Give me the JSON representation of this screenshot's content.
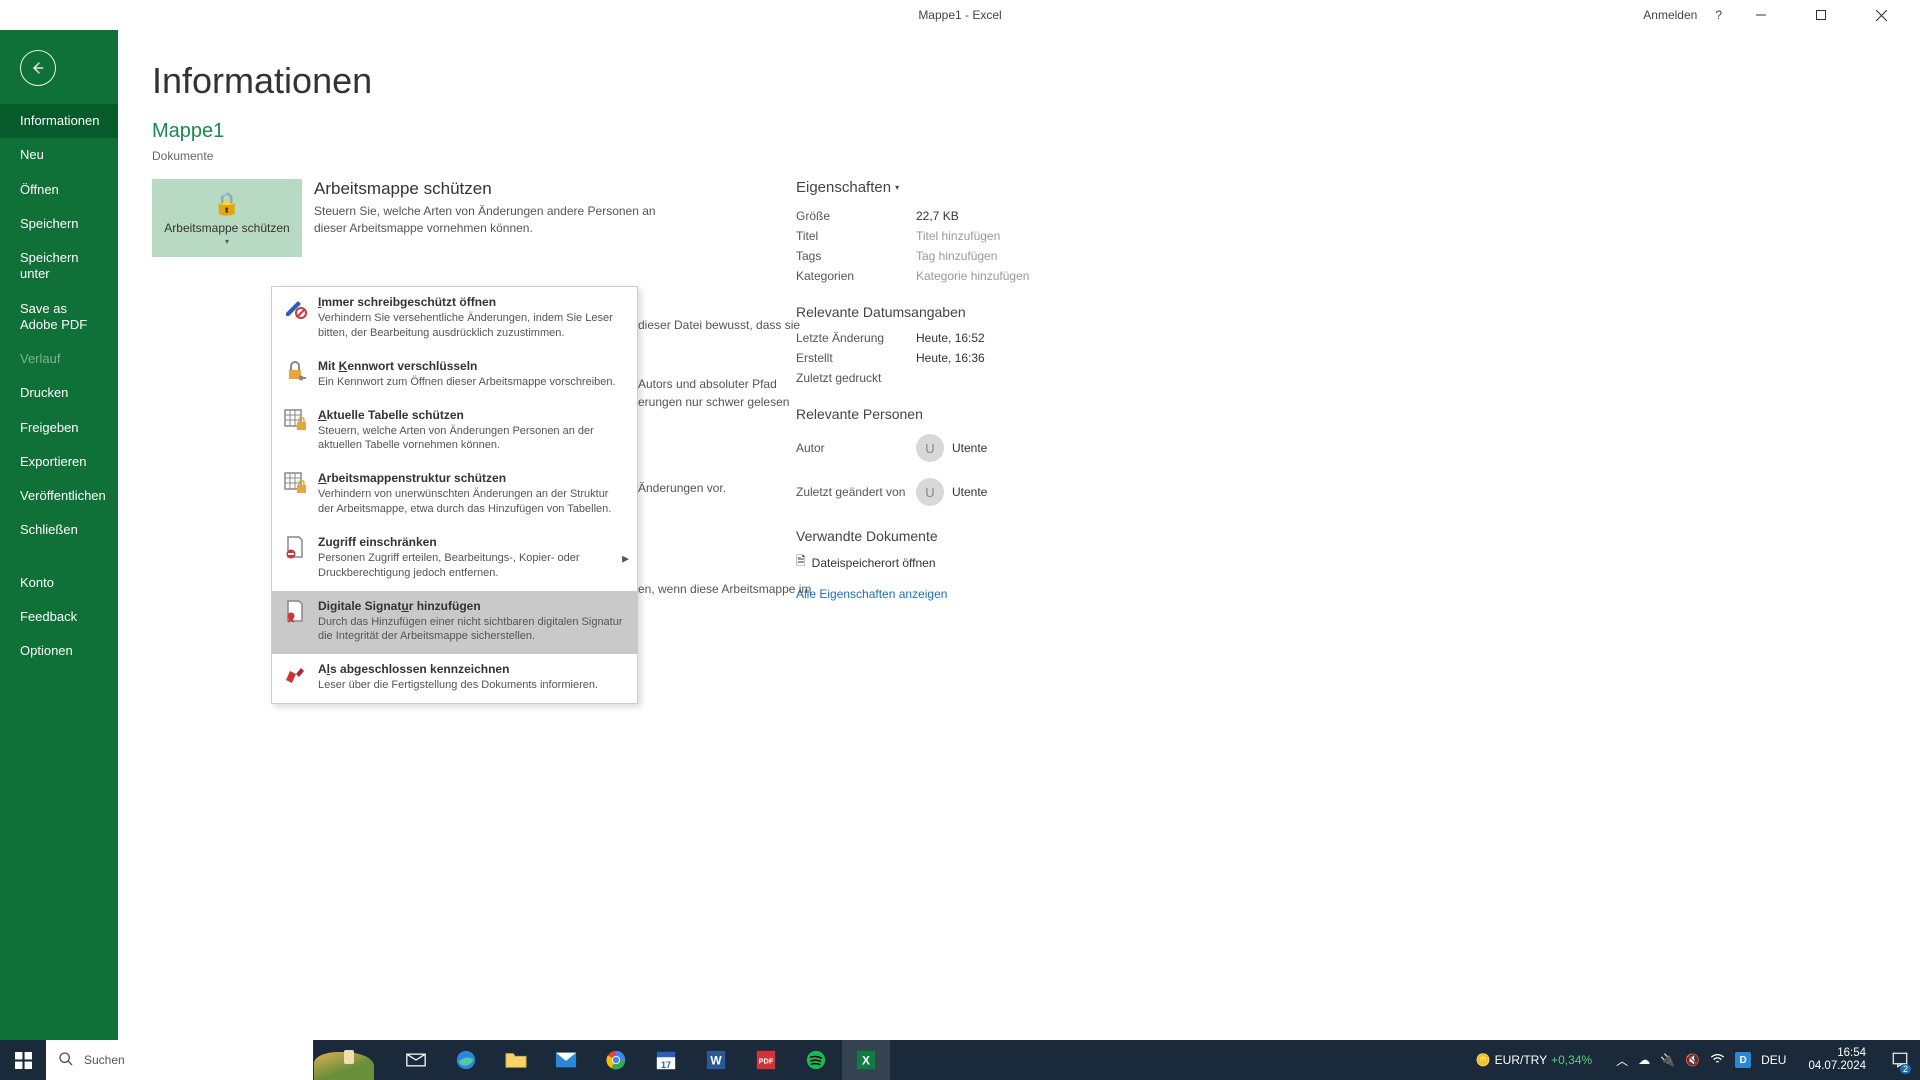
{
  "titlebar": {
    "title": "Mappe1  -  Excel",
    "sign_in": "Anmelden"
  },
  "sidebar": {
    "items": [
      {
        "label": "Informationen",
        "active": true
      },
      {
        "label": "Neu"
      },
      {
        "label": "Öffnen"
      },
      {
        "label": "Speichern"
      },
      {
        "label": "Speichern unter"
      },
      {
        "label": "Save as Adobe PDF"
      },
      {
        "label": "Verlauf",
        "disabled": true
      },
      {
        "label": "Drucken"
      },
      {
        "label": "Freigeben"
      },
      {
        "label": "Exportieren"
      },
      {
        "label": "Veröffentlichen"
      },
      {
        "label": "Schließen"
      }
    ],
    "footer": [
      {
        "label": "Konto"
      },
      {
        "label": "Feedback"
      },
      {
        "label": "Optionen"
      }
    ]
  },
  "page": {
    "title": "Informationen",
    "doc_name": "Mappe1",
    "doc_path": "Dokumente"
  },
  "protect": {
    "tile_label": "Arbeitsmappe schützen",
    "heading": "Arbeitsmappe schützen",
    "desc": "Steuern Sie, welche Arten von Änderungen andere Personen an dieser Arbeitsmappe vornehmen können."
  },
  "background_text": {
    "line1": "dieser Datei bewusst, dass sie",
    "line2": "Autors und absoluter Pfad",
    "line3": "erungen nur schwer gelesen",
    "line4": "Änderungen vor.",
    "line5": "en, wenn diese Arbeitsmappe im"
  },
  "menu": {
    "items": [
      {
        "title": "Immer schreibgeschützt öffnen",
        "key": "I",
        "desc": "Verhindern Sie versehentliche Änderungen, indem Sie Leser bitten, der Bearbeitung ausdrücklich zuzustimmen.",
        "icon": "pencil-block"
      },
      {
        "title": "Mit Kennwort verschlüsseln",
        "key": "K",
        "desc": "Ein Kennwort zum Öffnen dieser Arbeitsmappe vorschreiben.",
        "icon": "lock-key"
      },
      {
        "title": "Aktuelle Tabelle schützen",
        "key": "A",
        "desc": "Steuern, welche Arten von Änderungen Personen an der aktuellen Tabelle vornehmen können.",
        "icon": "sheet-lock"
      },
      {
        "title": "Arbeitsmappenstruktur schützen",
        "key": "A",
        "desc": "Verhindern von unerwünschten Änderungen an der Struktur der Arbeitsmappe, etwa durch das Hinzufügen von Tabellen.",
        "icon": "sheet-lock"
      },
      {
        "title": "Zugriff einschränken",
        "key": "",
        "desc": "Personen Zugriff erteilen, Bearbeitungs-, Kopier- oder Druckberechtigung jedoch entfernen.",
        "icon": "doc-deny",
        "submenu": true
      },
      {
        "title": "Digitale Signatur hinzufügen",
        "key": "u",
        "desc": "Durch das Hinzufügen einer nicht sichtbaren digitalen Signatur die Integrität der Arbeitsmappe sicherstellen.",
        "icon": "doc-ribbon",
        "highlight": true
      },
      {
        "title": "Als abgeschlossen kennzeichnen",
        "key": "l",
        "desc": "Leser über die Fertigstellung des Dokuments informieren.",
        "icon": "stamp"
      }
    ]
  },
  "props": {
    "header": "Eigenschaften",
    "rows": [
      {
        "label": "Größe",
        "value": "22,7 KB"
      },
      {
        "label": "Titel",
        "value": "Titel hinzufügen",
        "placeholder": true
      },
      {
        "label": "Tags",
        "value": "Tag hinzufügen",
        "placeholder": true
      },
      {
        "label": "Kategorien",
        "value": "Kategorie hinzufügen",
        "placeholder": true
      }
    ],
    "dates_header": "Relevante Datumsangaben",
    "dates": [
      {
        "label": "Letzte Änderung",
        "value": "Heute, 16:52"
      },
      {
        "label": "Erstellt",
        "value": "Heute, 16:36"
      },
      {
        "label": "Zuletzt gedruckt",
        "value": ""
      }
    ],
    "people_header": "Relevante Personen",
    "author_label": "Autor",
    "modified_by_label": "Zuletzt geändert von",
    "author_name": "Utente",
    "modified_by_name": "Utente",
    "avatar_initial": "U",
    "related_header": "Verwandte Dokumente",
    "open_location": "Dateispeicherort öffnen",
    "show_all": "Alle Eigenschaften anzeigen"
  },
  "taskbar": {
    "search_placeholder": "Suchen",
    "currency_pair": "EUR/TRY",
    "currency_rate": "+0,34%",
    "lang": "DEU",
    "time": "16:54",
    "date": "04.07.2024",
    "day_badge": "17",
    "notif_count": "2"
  }
}
